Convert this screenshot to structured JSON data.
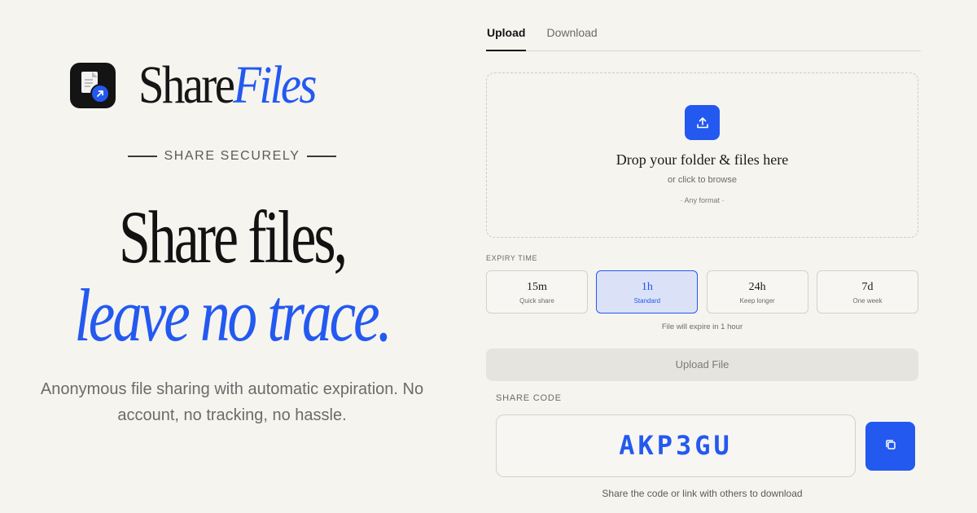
{
  "brand": {
    "name_part1": "Share",
    "name_part2": "Files",
    "logo_icon": "file-share-icon"
  },
  "hero": {
    "tagline": "SHARE SECURELY",
    "headline_line1": "Share files,",
    "headline_line2": "leave no trace.",
    "subtext": "Anonymous file sharing with automatic expiration. No account, no tracking, no hassle."
  },
  "tabs": [
    {
      "label": "Upload",
      "active": true
    },
    {
      "label": "Download",
      "active": false
    }
  ],
  "dropzone": {
    "icon": "upload-icon",
    "title": "Drop your folder & files here",
    "subtitle": "or click to browse",
    "formats": "· Any format ·"
  },
  "expiry": {
    "label": "EXPIRY TIME",
    "options": [
      {
        "value": "15m",
        "desc": "Quick share",
        "selected": false
      },
      {
        "value": "1h",
        "desc": "Standard",
        "selected": true
      },
      {
        "value": "24h",
        "desc": "Keep longer",
        "selected": false
      },
      {
        "value": "7d",
        "desc": "One week",
        "selected": false
      }
    ],
    "note": "File will expire in 1 hour"
  },
  "upload_button": "Upload File",
  "share": {
    "label": "SHARE CODE",
    "code": "AKP3GU",
    "copy_icon": "copy-icon",
    "note": "Share the code or link with others to download"
  },
  "colors": {
    "accent": "#2459f0",
    "background": "#f5f4ef",
    "selected_bg": "#dbe2f8"
  }
}
